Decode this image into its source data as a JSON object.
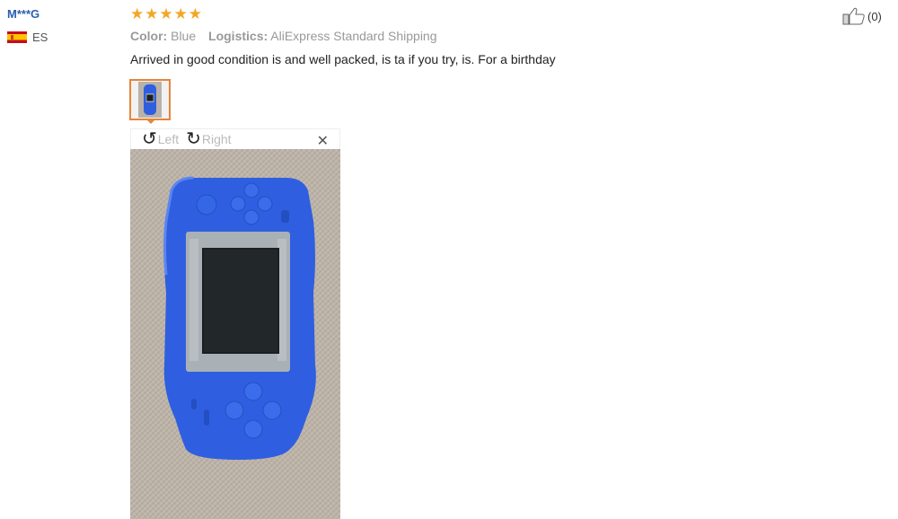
{
  "user": {
    "name": "M***G",
    "country_code": "ES",
    "flag_icon": "spain-flag-icon"
  },
  "review": {
    "rating": 5,
    "stars": [
      "★",
      "★",
      "★",
      "★",
      "★"
    ],
    "color_label": "Color:",
    "color_value": "Blue",
    "logistics_label": "Logistics:",
    "logistics_value": "AliExpress Standard Shipping",
    "feedback_text": "Arrived in good condition is and well packed, is ta if you try, is. For a birthday"
  },
  "viewer": {
    "rotate_left_label": "Left",
    "rotate_right_label": "Right",
    "rotate_left_icon": "rotate-left-icon",
    "rotate_right_icon": "rotate-right-icon",
    "close_icon": "close-icon",
    "close_glyph": "✕"
  },
  "like": {
    "icon": "thumbs-up-icon",
    "count": "(0)"
  },
  "colors": {
    "username": "#2a5db0",
    "stars": "#f5a623",
    "thumb_border": "#e8843b",
    "device_blue": "#2f5fe0"
  }
}
